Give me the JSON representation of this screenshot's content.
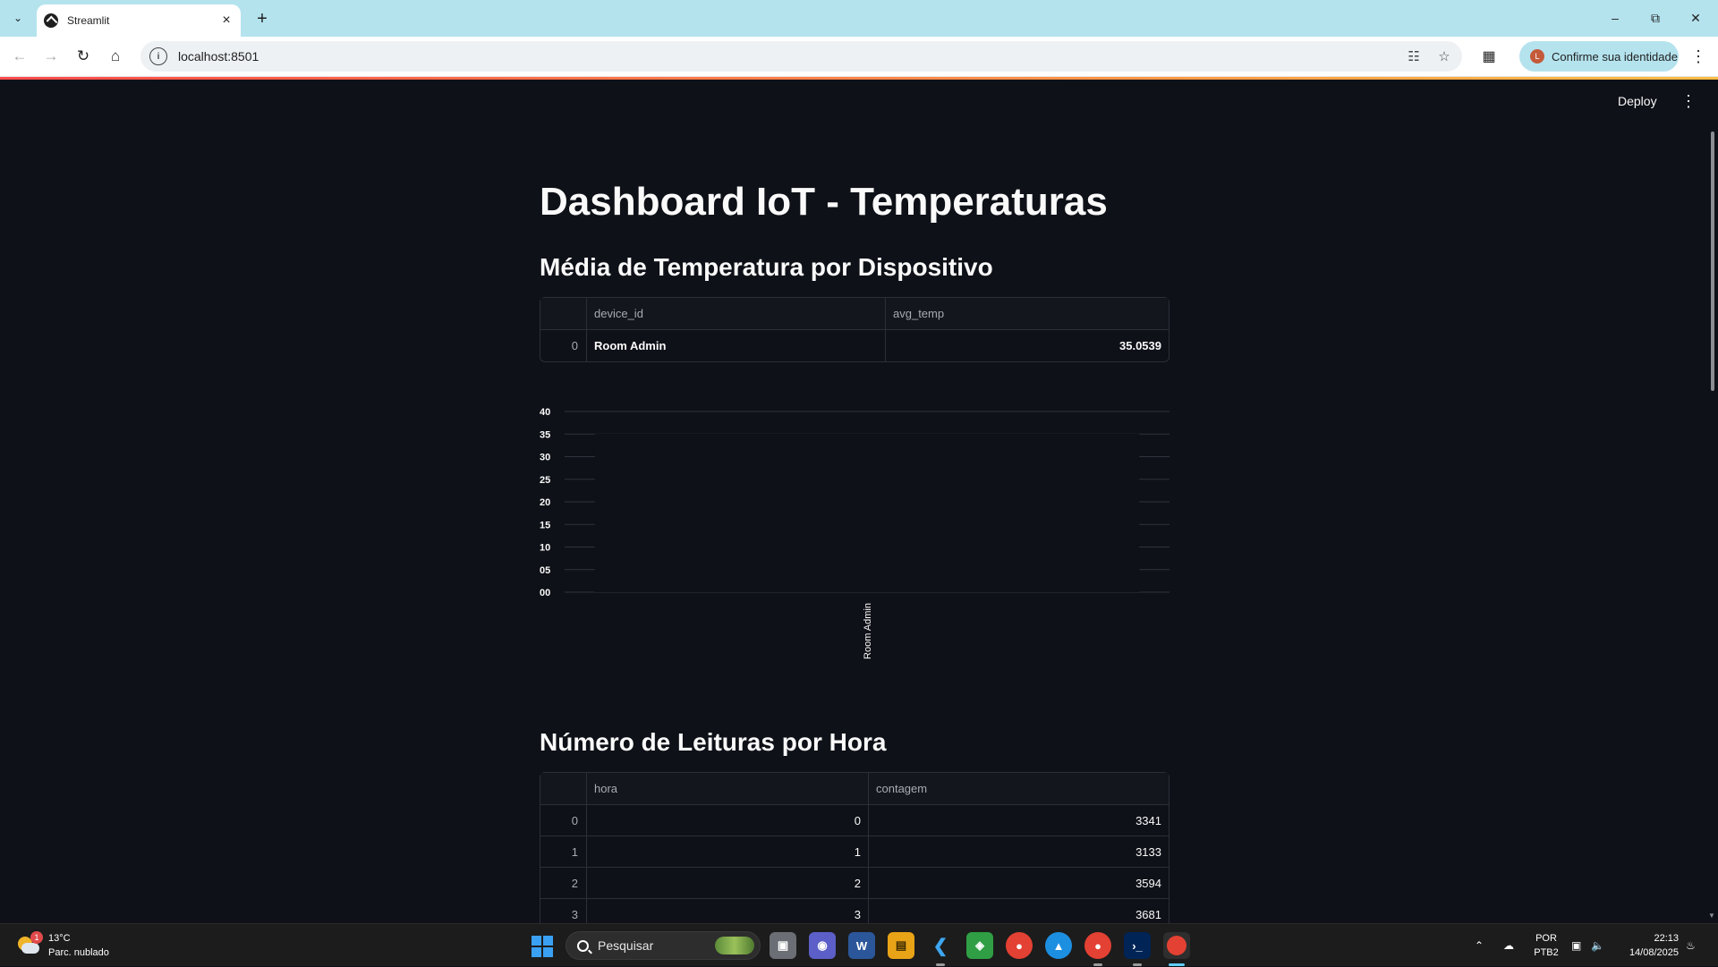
{
  "browser": {
    "tab_title": "Streamlit",
    "url": "localhost:8501",
    "profile_label": "Confirme sua identidade"
  },
  "app": {
    "deploy_label": "Deploy",
    "title": "Dashboard IoT - Temperaturas",
    "section1_title": "Média de Temperatura por Dispositivo",
    "section2_title": "Número de Leituras por Hora",
    "table1": {
      "columns": [
        "device_id",
        "avg_temp"
      ],
      "rows": [
        {
          "index": "0",
          "device_id": "Room Admin",
          "avg_temp": "35.0539"
        }
      ]
    },
    "table2": {
      "columns": [
        "hora",
        "contagem"
      ],
      "rows": [
        {
          "index": "0",
          "hora": "0",
          "contagem": "3341"
        },
        {
          "index": "1",
          "hora": "1",
          "contagem": "3133"
        },
        {
          "index": "2",
          "hora": "2",
          "contagem": "3594"
        },
        {
          "index": "3",
          "hora": "3",
          "contagem": "3681"
        }
      ]
    }
  },
  "chart_data": {
    "type": "bar",
    "categories": [
      "Room Admin"
    ],
    "values": [
      35.0539
    ],
    "ylim": [
      0,
      40
    ],
    "ytick_labels": [
      "00",
      "05",
      "10",
      "15",
      "20",
      "25",
      "30",
      "35",
      "40"
    ],
    "title": "",
    "xlabel": "",
    "ylabel": "",
    "grid": true,
    "bar_color": "#0e1117"
  },
  "taskbar": {
    "weather_temp": "13°C",
    "weather_desc": "Parc. nublado",
    "weather_badge": "1",
    "search_placeholder": "Pesquisar",
    "lang_top": "POR",
    "lang_bottom": "PTB2",
    "time": "22:13",
    "date": "14/08/2025"
  }
}
